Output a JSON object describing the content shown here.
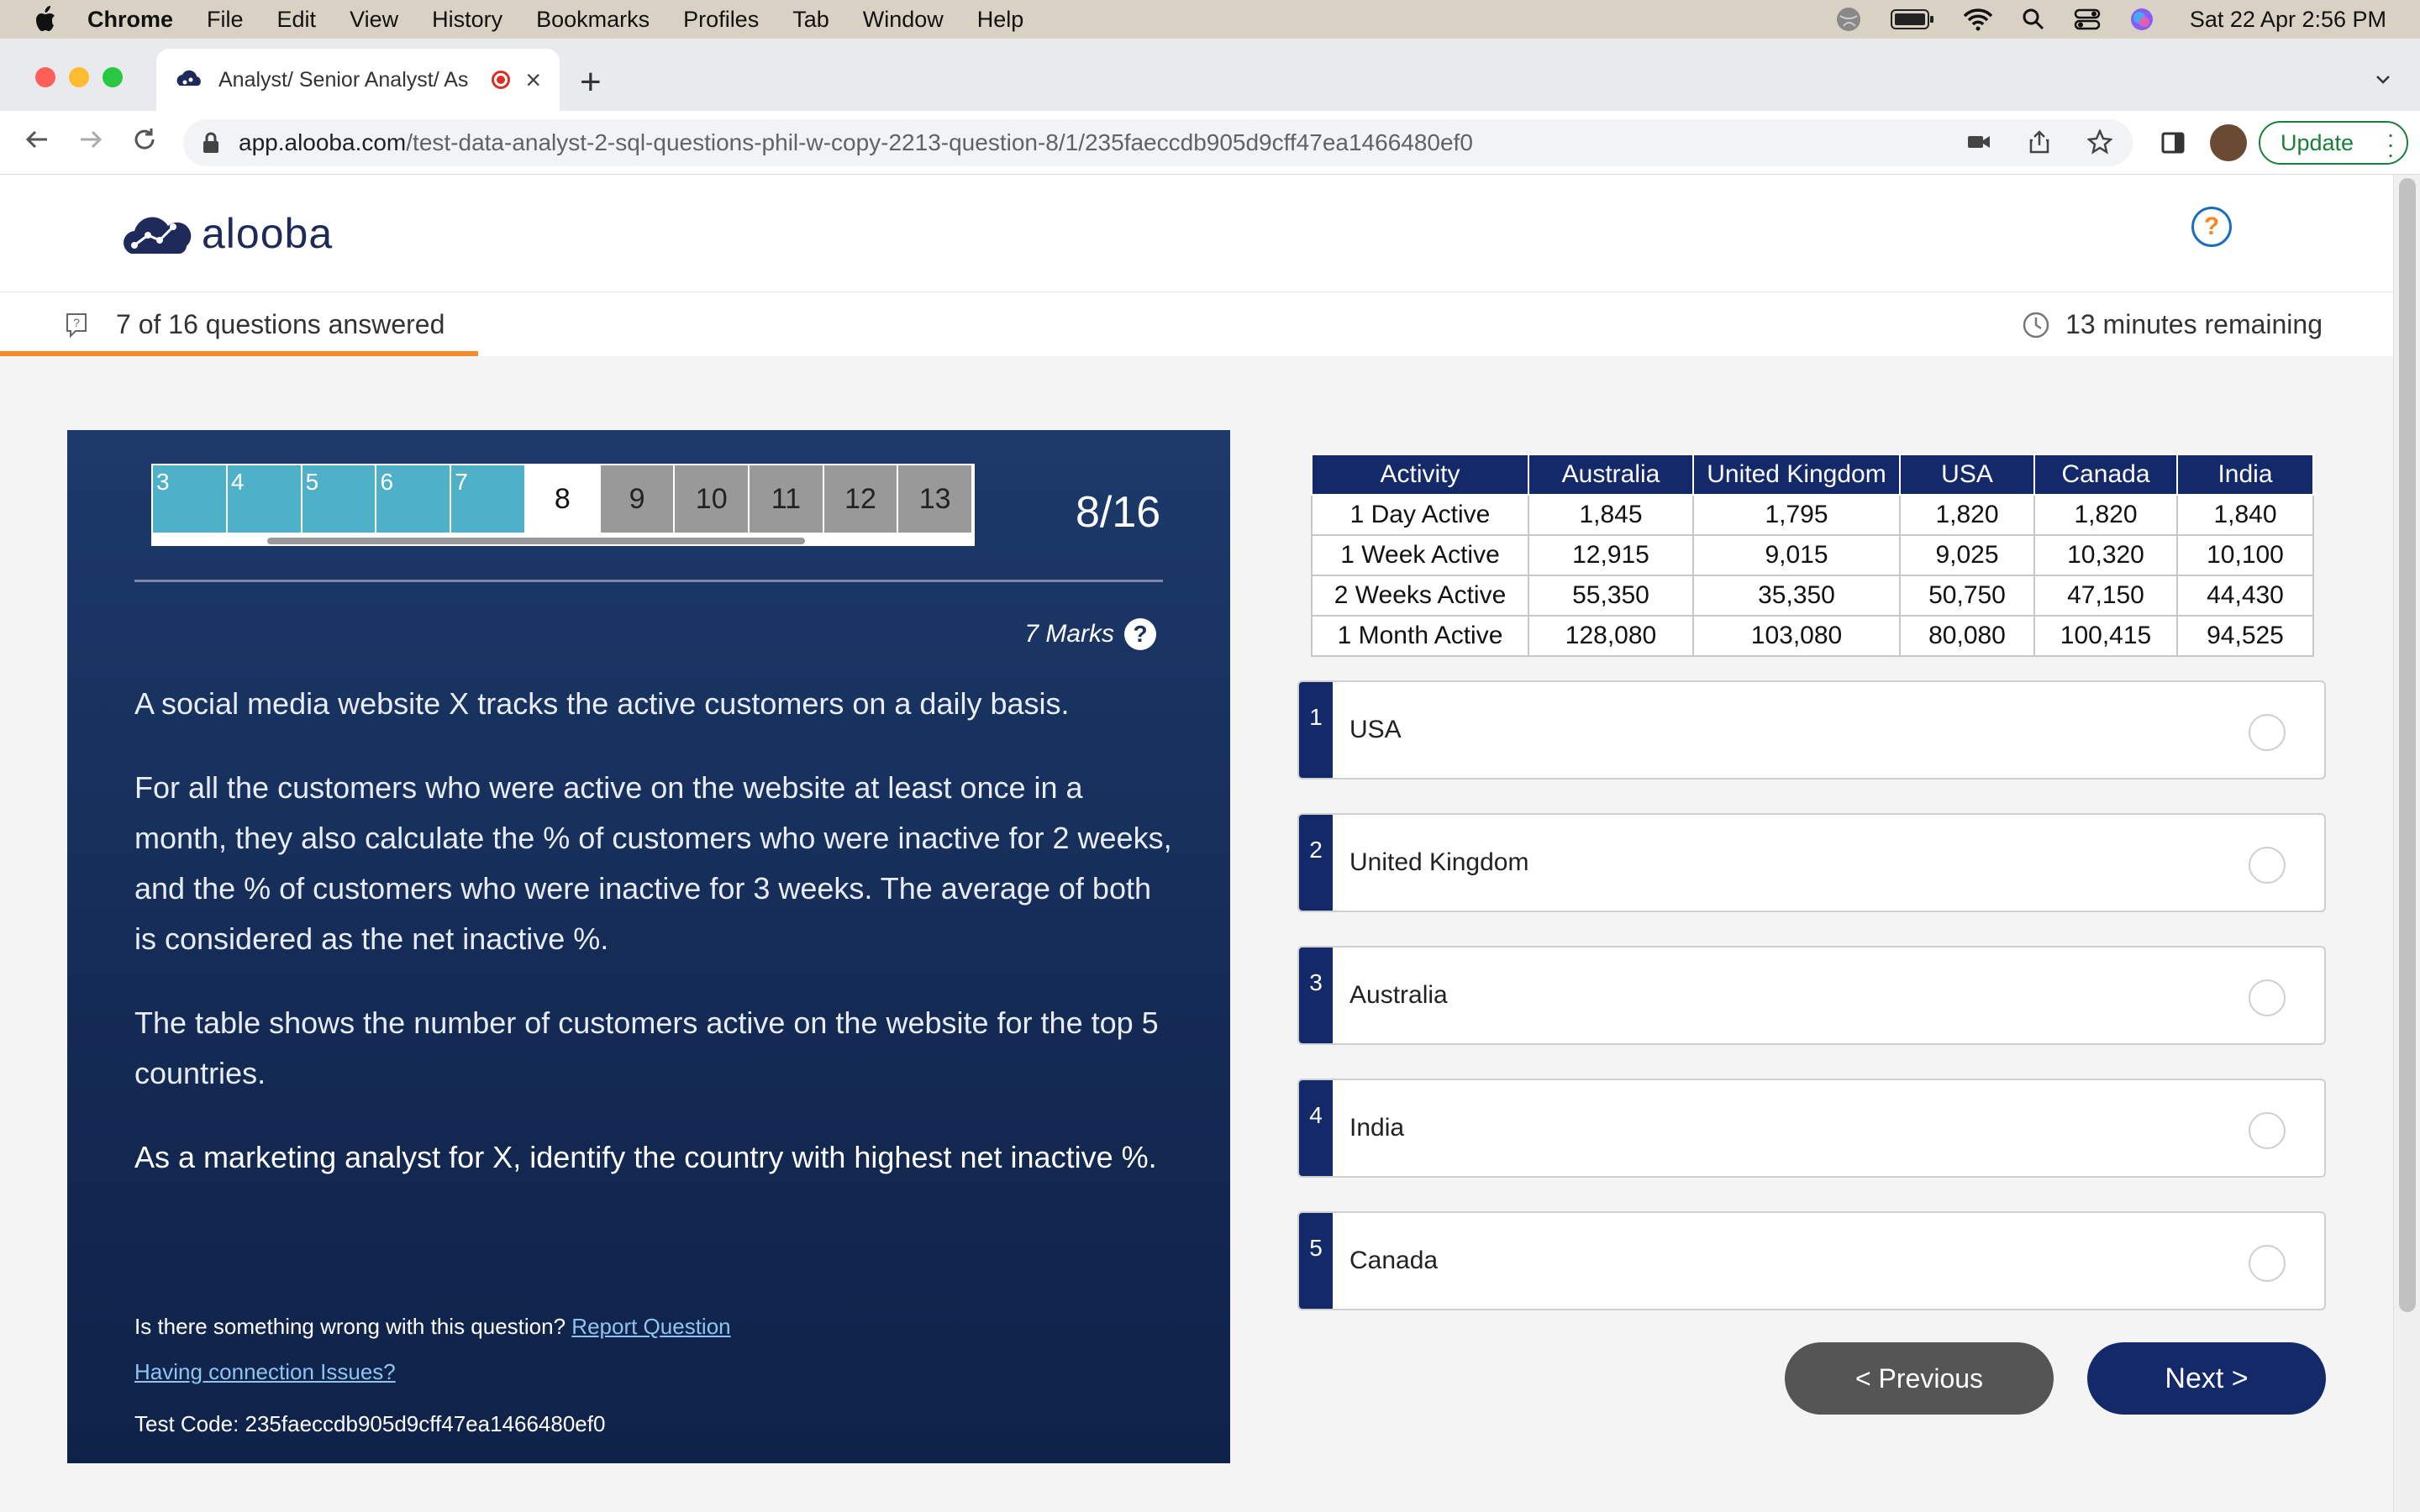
{
  "menubar": {
    "app": "Chrome",
    "items": [
      "File",
      "Edit",
      "View",
      "History",
      "Bookmarks",
      "Profiles",
      "Tab",
      "Window",
      "Help"
    ],
    "clock": "Sat 22 Apr  2:56 PM"
  },
  "browser": {
    "tab_title": "Analyst/ Senior Analyst/ As",
    "url_host": "app.alooba.com",
    "url_path": "/test-data-analyst-2-sql-questions-phil-w-copy-2213-question-8/1/235faeccdb905d9cff47ea1466480ef0",
    "update_label": "Update"
  },
  "site": {
    "logo_text": "alooba",
    "help_symbol": "?"
  },
  "status": {
    "answered_text": "7 of 16 questions answered",
    "remaining_text": "13 minutes remaining",
    "progress": 0.4375,
    "progress_color": "#f28c28"
  },
  "question_nav": {
    "cells": [
      {
        "label": "3",
        "state": "done"
      },
      {
        "label": "4",
        "state": "done"
      },
      {
        "label": "5",
        "state": "done"
      },
      {
        "label": "6",
        "state": "done"
      },
      {
        "label": "7",
        "state": "done"
      },
      {
        "label": "8",
        "state": "current"
      },
      {
        "label": "9",
        "state": "todo"
      },
      {
        "label": "10",
        "state": "todo"
      },
      {
        "label": "11",
        "state": "todo"
      },
      {
        "label": "12",
        "state": "todo"
      },
      {
        "label": "13",
        "state": "todo"
      }
    ],
    "counter": "8/16"
  },
  "question": {
    "marks": "7 Marks",
    "paragraphs": [
      "A social media website X tracks the active customers on a daily basis.",
      "For all the customers who were active on the website at least once in a month, they also calculate the % of customers who were inactive for 2 weeks, and the % of customers who were inactive for 3 weeks. The average of both is considered as the net inactive %.",
      "The table shows the number of customers active on the website for the top 5 countries.",
      "As a marketing analyst for X, identify the country with highest net inactive %."
    ],
    "report_prompt": "Is there something wrong with this question?",
    "report_link": "Report Question",
    "connection_link": "Having connection Issues?",
    "test_code": "Test Code: 235faeccdb905d9cff47ea1466480ef0"
  },
  "table": {
    "headers": [
      "Activity",
      "Australia",
      "United Kingdom",
      "USA",
      "Canada",
      "India"
    ],
    "rows": [
      [
        "1 Day Active",
        "1,845",
        "1,795",
        "1,820",
        "1,820",
        "1,840"
      ],
      [
        "1 Week Active",
        "12,915",
        "9,015",
        "9,025",
        "10,320",
        "10,100"
      ],
      [
        "2 Weeks Active",
        "55,350",
        "35,350",
        "50,750",
        "47,150",
        "44,430"
      ],
      [
        "1 Month Active",
        "128,080",
        "103,080",
        "80,080",
        "100,415",
        "94,525"
      ]
    ]
  },
  "options": [
    {
      "num": "1",
      "label": "USA"
    },
    {
      "num": "2",
      "label": "United Kingdom"
    },
    {
      "num": "3",
      "label": "Australia"
    },
    {
      "num": "4",
      "label": "India"
    },
    {
      "num": "5",
      "label": "Canada"
    }
  ],
  "buttons": {
    "previous": "< Previous",
    "next": "Next  >"
  },
  "colors": {
    "navy": "#13296a",
    "teal_done": "#4fb1c8",
    "orange": "#f28c28"
  }
}
